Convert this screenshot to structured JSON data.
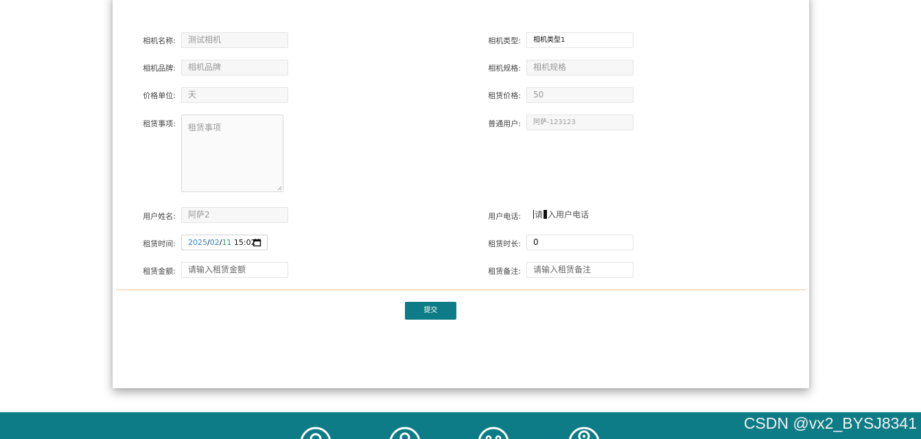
{
  "form": {
    "camera_name": {
      "label": "相机名称:",
      "value": "测试相机"
    },
    "camera_type": {
      "label": "相机类型:",
      "value": "相机类型1"
    },
    "camera_brand": {
      "label": "相机品牌:",
      "placeholder": "相机品牌"
    },
    "camera_spec": {
      "label": "相机规格:",
      "placeholder": "相机规格"
    },
    "price_unit": {
      "label": "价格单位:",
      "value": "天"
    },
    "rental_price": {
      "label": "租赁价格:",
      "value": "50"
    },
    "rental_notes_matter": {
      "label": "租赁事项:",
      "placeholder": "租赁事项"
    },
    "regular_user": {
      "label": "普通用户:",
      "value": "阿萨-123123"
    },
    "user_name": {
      "label": "用户姓名:",
      "value": "阿萨2"
    },
    "user_phone": {
      "label": "用户电话:",
      "placeholder_prefix": "请",
      "placeholder_rest": "入用户电话"
    },
    "rental_time": {
      "label": "租赁时间:",
      "year": "2025",
      "sep1": "/",
      "month": "02",
      "sep2": "/",
      "day": "11",
      "time": " 15:02"
    },
    "rental_duration": {
      "label": "租赁时长:",
      "value": "0"
    },
    "rental_amount": {
      "label": "租赁金额:",
      "placeholder": "请输入租赁金额"
    },
    "rental_remark": {
      "label": "租赁备注:",
      "placeholder": "请输入租赁备注"
    },
    "submit_label": "提交"
  },
  "footer": {
    "icons": [
      "user-circle-icon",
      "person-icon",
      "smile-icon",
      "location-pin-icon"
    ]
  },
  "watermark": "CSDN @vx2_BYSJ8341",
  "colors": {
    "accent": "#0e7c86",
    "divider": "#f4c3a3"
  }
}
